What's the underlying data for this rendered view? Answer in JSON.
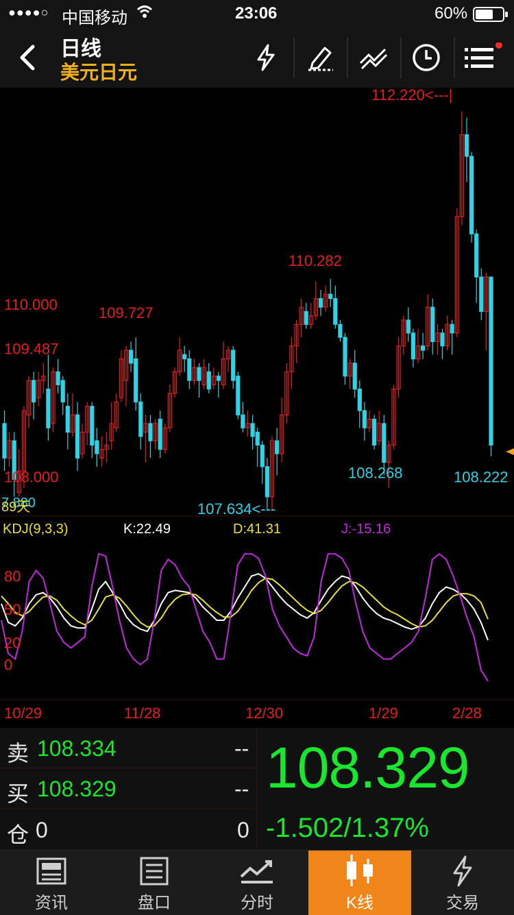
{
  "status_bar": {
    "carrier": "中国移动",
    "time": "23:06",
    "battery": "60%"
  },
  "header": {
    "title": "日线",
    "subtitle": "美元日元"
  },
  "toolbar_icons": [
    "flash-icon",
    "draw-icon",
    "indicator-icon",
    "clock-icon",
    "menu-icon"
  ],
  "colors": {
    "up": "#e51f1f",
    "down": "#2fd3e6",
    "accent": "#f0851a",
    "gain": "#19e62c",
    "k_line": "#ffffff",
    "d_line": "#e8e03a",
    "j_line": "#c328e0"
  },
  "chart_data": [
    {
      "type": "candlestick",
      "ylim": [
        107.55,
        112.4
      ],
      "price_labels": [
        {
          "label": "110.000",
          "value": 110.0
        },
        {
          "label": "109.487",
          "value": 109.487
        },
        {
          "label": "108.000",
          "value": 108.0
        }
      ],
      "annotations": [
        {
          "text": "112.220<---|",
          "value": 112.22,
          "color": "up"
        },
        {
          "text": "110.282",
          "value": 110.282,
          "color": "up"
        },
        {
          "text": "109.727",
          "value": 109.727,
          "color": "up"
        },
        {
          "text": "108.268",
          "value": 108.268,
          "color": "down"
        },
        {
          "text": "108.222",
          "value": 108.222,
          "color": "down"
        },
        {
          "text": "107.634<---",
          "value": 107.634,
          "color": "down"
        }
      ],
      "overlay_texts": [
        "7.880",
        "89天"
      ],
      "x_labels": [
        "10/29",
        "11/28",
        "12/30",
        "1/29",
        "2/28"
      ],
      "candles": [
        [
          108.6,
          108.2,
          108.75,
          108.05
        ],
        [
          108.2,
          108.4,
          108.5,
          108.1
        ],
        [
          108.4,
          107.95,
          108.5,
          107.75
        ],
        [
          107.8,
          108.05,
          108.3,
          107.75
        ],
        [
          108.05,
          108.75,
          108.8,
          107.85
        ],
        [
          108.7,
          109.1,
          109.15,
          108.55
        ],
        [
          109.1,
          108.85,
          109.2,
          108.65
        ],
        [
          108.9,
          109.1,
          109.2,
          108.8
        ],
        [
          109.1,
          109.15,
          109.3,
          108.95
        ],
        [
          109.0,
          108.55,
          109.4,
          108.4
        ],
        [
          108.6,
          109.2,
          109.25,
          108.5
        ],
        [
          109.2,
          109.05,
          109.35,
          108.95
        ],
        [
          109.1,
          108.85,
          109.15,
          108.7
        ],
        [
          108.8,
          108.5,
          108.95,
          108.3
        ],
        [
          108.5,
          108.7,
          108.95,
          108.45
        ],
        [
          108.7,
          108.2,
          108.85,
          108.05
        ],
        [
          108.25,
          108.5,
          108.6,
          108.2
        ],
        [
          108.5,
          108.8,
          108.85,
          108.35
        ],
        [
          108.8,
          108.35,
          108.85,
          108.2
        ],
        [
          108.4,
          108.25,
          108.55,
          108.1
        ],
        [
          108.2,
          108.3,
          108.45,
          108.1
        ],
        [
          108.3,
          108.35,
          108.5,
          108.15
        ],
        [
          108.4,
          108.6,
          108.85,
          108.3
        ],
        [
          108.55,
          108.85,
          108.95,
          108.5
        ],
        [
          108.9,
          109.35,
          109.45,
          108.85
        ],
        [
          109.1,
          109.45,
          109.5,
          108.8
        ],
        [
          109.45,
          109.3,
          109.55,
          109.2
        ],
        [
          109.35,
          108.85,
          109.6,
          108.75
        ],
        [
          108.85,
          108.45,
          108.95,
          108.3
        ],
        [
          108.5,
          108.6,
          108.7,
          108.15
        ],
        [
          108.6,
          108.4,
          108.7,
          108.2
        ],
        [
          108.4,
          108.6,
          108.65,
          108.3
        ],
        [
          108.65,
          108.3,
          108.75,
          108.2
        ],
        [
          108.3,
          108.55,
          108.6,
          108.25
        ],
        [
          108.55,
          108.95,
          109.05,
          108.5
        ],
        [
          108.95,
          109.2,
          109.25,
          108.9
        ],
        [
          109.2,
          109.45,
          109.6,
          109.15
        ],
        [
          109.4,
          109.35,
          109.5,
          109.2
        ],
        [
          109.35,
          109.1,
          109.45,
          109.0
        ],
        [
          109.1,
          109.25,
          109.35,
          109.05
        ],
        [
          109.25,
          109.1,
          109.3,
          108.9
        ],
        [
          109.05,
          109.25,
          109.35,
          109.0
        ],
        [
          109.2,
          109.0,
          109.3,
          108.95
        ],
        [
          109.05,
          109.15,
          109.25,
          109.0
        ],
        [
          109.15,
          109.1,
          109.2,
          108.9
        ],
        [
          109.05,
          109.35,
          109.55,
          109.0
        ],
        [
          109.35,
          109.45,
          109.5,
          109.2
        ],
        [
          109.45,
          109.1,
          109.5,
          109.0
        ],
        [
          109.15,
          108.7,
          109.2,
          108.65
        ],
        [
          108.7,
          108.55,
          108.85,
          108.5
        ],
        [
          108.55,
          108.6,
          108.75,
          108.45
        ],
        [
          108.6,
          108.45,
          108.7,
          108.3
        ],
        [
          108.5,
          108.35,
          108.55,
          108.1
        ],
        [
          108.35,
          108.1,
          108.4,
          107.9
        ],
        [
          108.1,
          107.75,
          108.2,
          107.6
        ],
        [
          107.75,
          108.4,
          108.45,
          107.6
        ],
        [
          108.4,
          108.25,
          108.55,
          108.0
        ],
        [
          108.25,
          108.7,
          108.9,
          108.15
        ],
        [
          108.7,
          109.2,
          109.3,
          108.6
        ],
        [
          109.2,
          109.5,
          109.6,
          109.0
        ],
        [
          109.5,
          109.75,
          109.8,
          109.3
        ],
        [
          109.75,
          109.95,
          110.05,
          109.6
        ],
        [
          109.9,
          109.75,
          110.0,
          109.7
        ],
        [
          109.75,
          109.85,
          110.0,
          109.7
        ],
        [
          109.85,
          110.05,
          110.25,
          109.8
        ],
        [
          110.05,
          109.95,
          110.15,
          109.85
        ],
        [
          109.95,
          110.1,
          110.2,
          109.9
        ],
        [
          110.1,
          110.05,
          110.28,
          109.95
        ],
        [
          110.05,
          109.75,
          110.2,
          109.7
        ],
        [
          109.75,
          109.6,
          109.8,
          109.55
        ],
        [
          109.6,
          109.15,
          109.65,
          109.05
        ],
        [
          109.15,
          109.3,
          109.35,
          109.0
        ],
        [
          109.3,
          109.0,
          109.45,
          108.9
        ],
        [
          109.0,
          108.75,
          109.1,
          108.55
        ],
        [
          108.75,
          108.55,
          108.85,
          108.4
        ],
        [
          108.55,
          108.65,
          108.75,
          108.5
        ],
        [
          108.65,
          108.35,
          108.7,
          108.3
        ],
        [
          108.4,
          108.6,
          108.75,
          108.35
        ],
        [
          108.6,
          108.15,
          108.7,
          108.0
        ],
        [
          108.15,
          108.35,
          108.4,
          107.85
        ],
        [
          108.35,
          109.0,
          109.05,
          108.3
        ],
        [
          109.0,
          109.5,
          109.6,
          108.9
        ],
        [
          109.5,
          109.8,
          109.85,
          109.4
        ],
        [
          109.8,
          109.65,
          109.95,
          109.55
        ],
        [
          109.65,
          109.35,
          109.7,
          109.25
        ],
        [
          109.35,
          109.5,
          109.7,
          109.3
        ],
        [
          109.5,
          109.45,
          109.65,
          109.35
        ],
        [
          109.5,
          109.95,
          110.1,
          109.45
        ],
        [
          109.95,
          109.55,
          110.05,
          109.4
        ],
        [
          109.55,
          109.65,
          109.75,
          109.4
        ],
        [
          109.65,
          109.5,
          109.7,
          109.35
        ],
        [
          109.5,
          109.75,
          109.85,
          109.45
        ],
        [
          109.75,
          109.65,
          109.8,
          109.4
        ],
        [
          109.65,
          111.0,
          111.1,
          109.6
        ],
        [
          111.0,
          111.95,
          112.22,
          110.9
        ],
        [
          111.95,
          111.7,
          112.15,
          111.4
        ],
        [
          111.7,
          110.8,
          111.75,
          110.7
        ],
        [
          110.8,
          110.3,
          110.85,
          110.0
        ],
        [
          110.3,
          109.9,
          110.4,
          109.8
        ],
        [
          109.9,
          110.3,
          110.35,
          109.45
        ],
        [
          110.3,
          108.35,
          109.75,
          108.22
        ]
      ]
    },
    {
      "type": "line",
      "title": "KDJ(9,3,3)",
      "values_text": {
        "k": "K:22.49",
        "d": "D:41.31",
        "j": "J:-15.16"
      },
      "y_ticks": [
        "80",
        "50",
        "20",
        "0"
      ],
      "ylim": [
        -25,
        105
      ],
      "series": [
        {
          "name": "K",
          "values": [
            55,
            38,
            35,
            42,
            55,
            63,
            65,
            60,
            52,
            42,
            35,
            33,
            33,
            50,
            68,
            75,
            65,
            55,
            43,
            36,
            32,
            30,
            40,
            55,
            65,
            67,
            66,
            65,
            60,
            52,
            46,
            40,
            40,
            48,
            60,
            70,
            80,
            82,
            78,
            70,
            62,
            55,
            50,
            45,
            42,
            47,
            58,
            68,
            75,
            80,
            78,
            70,
            60,
            52,
            46,
            42,
            40,
            37,
            34,
            32,
            34,
            42,
            55,
            65,
            70,
            68,
            64,
            58,
            50,
            38,
            22
          ]
        },
        {
          "name": "D",
          "values": [
            62,
            55,
            47,
            44,
            48,
            55,
            61,
            62,
            58,
            50,
            44,
            39,
            36,
            40,
            50,
            61,
            63,
            60,
            53,
            45,
            38,
            34,
            35,
            42,
            52,
            59,
            63,
            64,
            63,
            58,
            52,
            47,
            43,
            43,
            48,
            57,
            67,
            74,
            78,
            77,
            72,
            66,
            60,
            54,
            49,
            46,
            49,
            56,
            64,
            71,
            75,
            74,
            70,
            64,
            58,
            52,
            48,
            45,
            41,
            37,
            34,
            35,
            40,
            48,
            56,
            62,
            64,
            64,
            62,
            56,
            41
          ]
        },
        {
          "name": "J",
          "values": [
            40,
            10,
            5,
            30,
            75,
            85,
            78,
            55,
            30,
            20,
            15,
            20,
            25,
            70,
            100,
            98,
            70,
            40,
            15,
            5,
            0,
            5,
            40,
            85,
            95,
            90,
            78,
            70,
            50,
            30,
            20,
            5,
            5,
            45,
            90,
            100,
            100,
            96,
            80,
            50,
            35,
            25,
            15,
            10,
            8,
            25,
            75,
            100,
            100,
            96,
            85,
            55,
            30,
            15,
            10,
            5,
            5,
            10,
            15,
            20,
            30,
            60,
            95,
            100,
            95,
            80,
            62,
            42,
            25,
            -5,
            -15
          ]
        }
      ]
    }
  ],
  "quote": {
    "sell_label": "卖",
    "sell_price": "108.334",
    "sell_dash": "--",
    "buy_label": "买",
    "buy_price": "108.329",
    "buy_dash": "--",
    "pos_label": "仓",
    "pos_value": "0",
    "pos_right": "0",
    "last_price": "108.329",
    "change": "-1.502/1.37%"
  },
  "tabs": [
    {
      "label": "资讯",
      "icon": "news-icon"
    },
    {
      "label": "盘口",
      "icon": "orderbook-icon"
    },
    {
      "label": "分时",
      "icon": "timeshare-icon"
    },
    {
      "label": "K线",
      "icon": "candlestick-icon",
      "active": true
    },
    {
      "label": "交易",
      "icon": "trade-icon"
    }
  ]
}
